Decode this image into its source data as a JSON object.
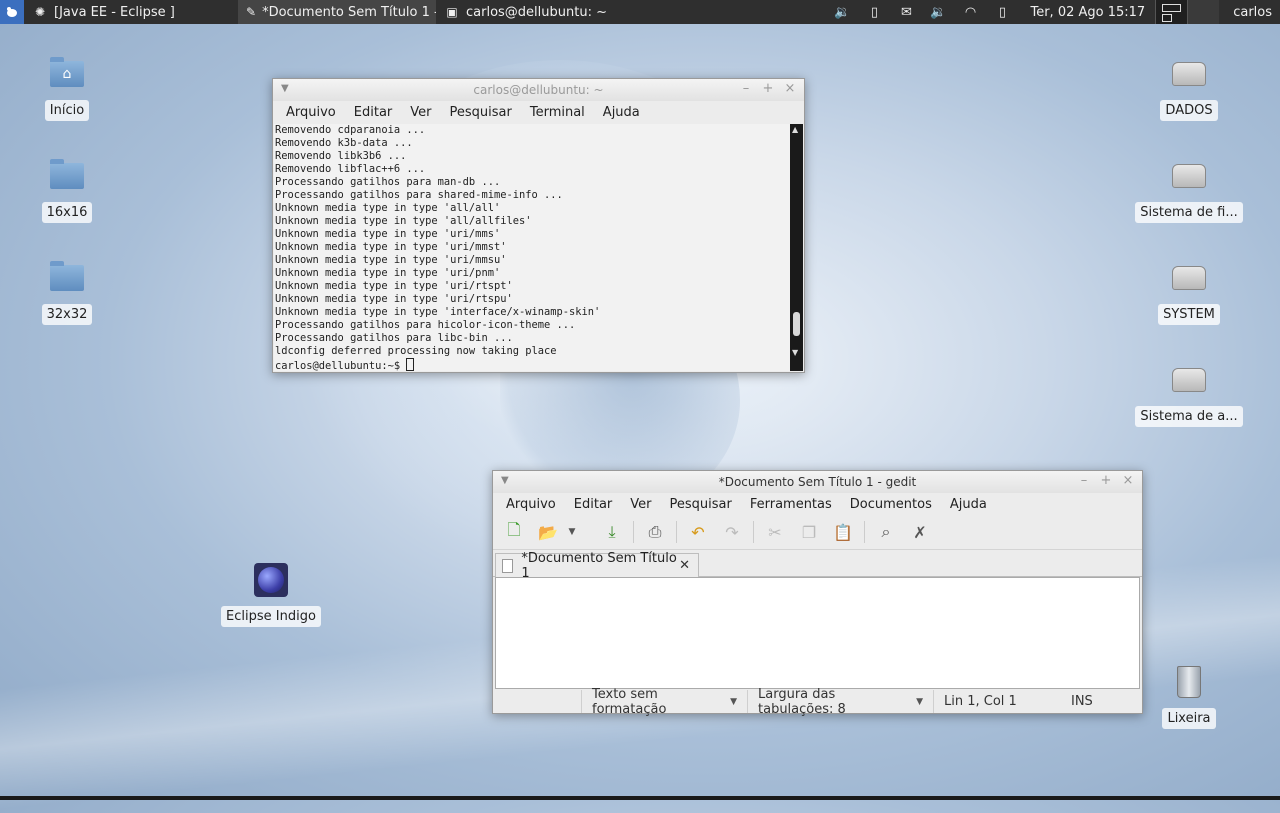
{
  "panel": {
    "tasks": [
      {
        "label": "[Java EE - Eclipse ]",
        "icon": "eclipse-icon"
      },
      {
        "label": "*Documento Sem Título 1 -...",
        "icon": "text-editor-icon"
      },
      {
        "label": "carlos@dellubuntu: ~",
        "icon": "terminal-icon"
      }
    ],
    "clock": "Ter, 02 Ago  15:17",
    "user": "carlos",
    "tray_icons": [
      "volume-icon",
      "battery-icon",
      "mail-icon",
      "volume-icon",
      "wifi-icon",
      "battery-icon"
    ]
  },
  "desktop": {
    "left_icons": [
      {
        "label": "Início",
        "icon": "home-folder-icon"
      },
      {
        "label": "16x16",
        "icon": "folder-icon"
      },
      {
        "label": "32x32",
        "icon": "folder-icon"
      },
      {
        "label": "Eclipse Indigo",
        "icon": "eclipse-icon"
      }
    ],
    "right_icons": [
      {
        "label": "DADOS",
        "icon": "drive-icon"
      },
      {
        "label": "Sistema de fi...",
        "icon": "drive-icon"
      },
      {
        "label": "SYSTEM",
        "icon": "drive-icon"
      },
      {
        "label": "Sistema de a...",
        "icon": "drive-icon"
      },
      {
        "label": "Lixeira",
        "icon": "trash-icon"
      }
    ]
  },
  "terminal": {
    "title": "carlos@dellubuntu: ~",
    "menu": [
      "Arquivo",
      "Editar",
      "Ver",
      "Pesquisar",
      "Terminal",
      "Ajuda"
    ],
    "lines": [
      "Removendo cdparanoia ...",
      "Removendo k3b-data ...",
      "Removendo libk3b6 ...",
      "Removendo libflac++6 ...",
      "Processando gatilhos para man-db ...",
      "Processando gatilhos para shared-mime-info ...",
      "Unknown media type in type 'all/all'",
      "Unknown media type in type 'all/allfiles'",
      "Unknown media type in type 'uri/mms'",
      "Unknown media type in type 'uri/mmst'",
      "Unknown media type in type 'uri/mmsu'",
      "Unknown media type in type 'uri/pnm'",
      "Unknown media type in type 'uri/rtspt'",
      "Unknown media type in type 'uri/rtspu'",
      "Unknown media type in type 'interface/x-winamp-skin'",
      "Processando gatilhos para hicolor-icon-theme ...",
      "Processando gatilhos para libc-bin ...",
      "ldconfig deferred processing now taking place"
    ],
    "prompt": "carlos@dellubuntu:~$ "
  },
  "gedit": {
    "title": "*Documento Sem Título 1 - gedit",
    "menu": [
      "Arquivo",
      "Editar",
      "Ver",
      "Pesquisar",
      "Ferramentas",
      "Documentos",
      "Ajuda"
    ],
    "tab_label": "*Documento Sem Título 1",
    "status": {
      "syntax": "Texto sem formatação",
      "tab_width": "Largura das tabulações:  8",
      "position": "Lin 1, Col 1",
      "mode": "INS"
    }
  }
}
